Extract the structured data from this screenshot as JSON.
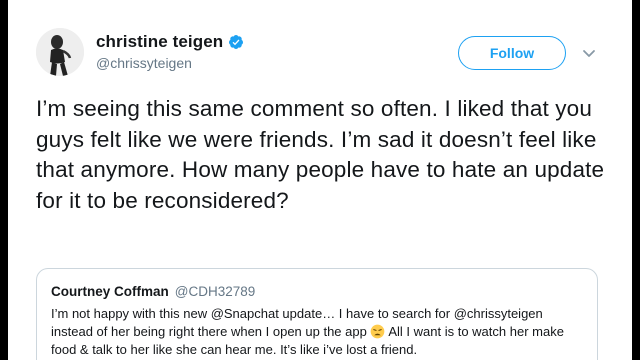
{
  "tweet": {
    "author_name": "christine teigen",
    "author_handle": "@chrissyteigen",
    "follow_label": "Follow",
    "text": "I’m seeing this same comment so often. I liked that you guys felt like we were friends. I’m sad it doesn’t feel like that anymore. How many people have to hate an update for it to be reconsidered?"
  },
  "quoted_tweet": {
    "author_name": "Courtney Coffman",
    "author_handle": "@CDH32789",
    "text_before_emoji": "I’m not happy with this new @Snapchat update… I have to search for @chrissyteigen instead of her being right there when I open up the app ",
    "text_after_emoji": " All I want is to watch her make food & talk to her like she can hear me. It’s like i’ve lost a friend.",
    "emoji_icon": "weary-face-emoji"
  },
  "icons": {
    "verified": "verified-badge-icon",
    "more": "chevron-down-icon"
  },
  "colors": {
    "accent": "#1da1f2",
    "text": "#14171a",
    "muted": "#657786",
    "border": "#ccd6dd"
  }
}
